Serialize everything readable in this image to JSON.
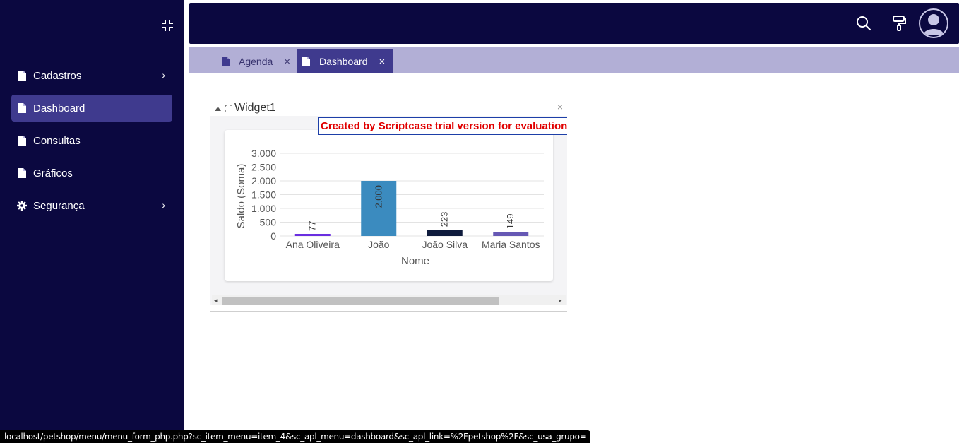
{
  "sidebar": {
    "items": [
      {
        "label": "Cadastros",
        "icon": "file-icon",
        "has_submenu": true,
        "active": false
      },
      {
        "label": "Dashboard",
        "icon": "file-icon",
        "has_submenu": false,
        "active": true
      },
      {
        "label": "Consultas",
        "icon": "file-icon",
        "has_submenu": false,
        "active": false
      },
      {
        "label": "Gráficos",
        "icon": "file-icon",
        "has_submenu": false,
        "active": false
      },
      {
        "label": "Segurança",
        "icon": "gear-icon",
        "has_submenu": true,
        "active": false
      }
    ]
  },
  "tabs": [
    {
      "label": "Agenda",
      "close": "×"
    },
    {
      "label": "Dashboard",
      "close": "×"
    }
  ],
  "widget": {
    "title": "Widget1",
    "close": "×",
    "trial_notice": "Created by Scriptcase trial version for evaluation p"
  },
  "chart_data": {
    "type": "bar",
    "categories": [
      "Ana Oliveira",
      "João",
      "João Silva",
      "Maria Santos"
    ],
    "values": [
      77,
      2000,
      223,
      149
    ],
    "value_labels": [
      "77",
      "2.000",
      "223",
      "149"
    ],
    "bar_colors": [
      "#6a2ee0",
      "#3b8bbf",
      "#0f1b3d",
      "#6658b4"
    ],
    "xlabel": "Nome",
    "ylabel": "Saldo (Soma)",
    "ylim": [
      0,
      3000
    ],
    "yticks": [
      0,
      500,
      1000,
      1500,
      2000,
      2500,
      3000
    ],
    "ytick_labels": [
      "0",
      "500",
      "1.000",
      "1.500",
      "2.000",
      "2.500",
      "3.000"
    ],
    "grid": true,
    "legend": false
  },
  "status_url": "localhost/petshop/menu/menu_form_php.php?sc_item_menu=item_4&sc_apl_menu=dashboard&sc_apl_link=%2Fpetshop%2F&sc_usa_grupo=",
  "colors": {
    "sidebar_bg": "#0b0840",
    "accent": "#3f3a8e",
    "tabsbar_bg": "#b2afd6",
    "trial_text": "#e00000"
  }
}
